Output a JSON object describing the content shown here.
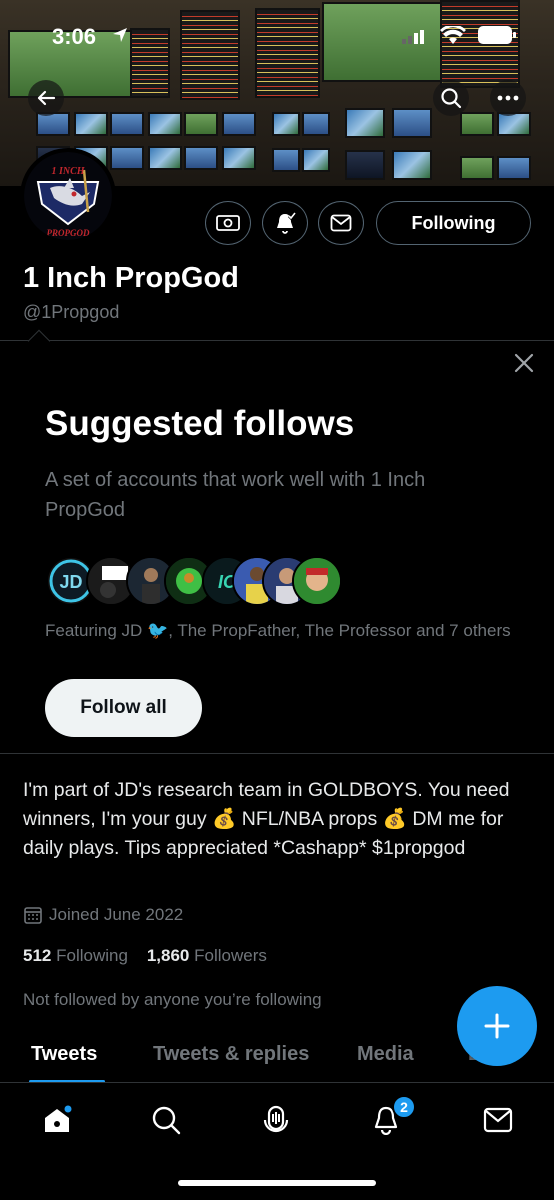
{
  "status_bar": {
    "time": "3:06"
  },
  "profile": {
    "name": "1 Inch PropGod",
    "handle": "@1Propgod",
    "logo_text_top": "1 INCH",
    "logo_text_bottom": "PROPGOD",
    "following_button": "Following"
  },
  "suggested": {
    "title": "Suggested follows",
    "subtitle": "A set of accounts that work well with 1 Inch PropGod",
    "featuring": "Featuring JD 🐦, The PropFather, The Professor and 7 others",
    "follow_all": "Follow all"
  },
  "bio": {
    "text": "I'm part of JD's research team in GOLDBOYS. You need winners, I'm your guy 💰 NFL/NBA props 💰 DM me for daily plays. Tips appreciated *Cashapp* $1propgod",
    "joined": "Joined June 2022",
    "following_count": "512",
    "following_label": "Following",
    "followers_count": "1,860",
    "followers_label": "Followers",
    "not_followed": "Not followed by anyone you’re following"
  },
  "tabs": [
    "Tweets",
    "Tweets & replies",
    "Media",
    "Likes"
  ],
  "nav": {
    "notifications_badge": "2"
  },
  "colors": {
    "accent": "#1d9bf0",
    "muted": "#71767b",
    "border": "#2f3336"
  }
}
